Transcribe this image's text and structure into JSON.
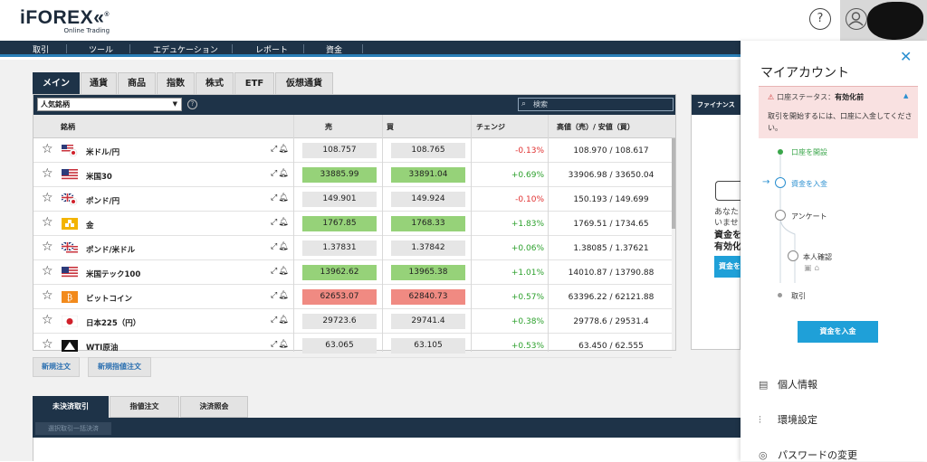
{
  "header": {
    "logo_main": "iFOREX",
    "logo_mark": "«",
    "logo_reg": "®",
    "logo_sub": "Online Trading",
    "help_icon": "?"
  },
  "nav": [
    "取引",
    "ツール",
    "エデュケーション",
    "レポート",
    "資金"
  ],
  "tabs": [
    "メイン",
    "通貨",
    "商品",
    "指数",
    "株式",
    "ETF",
    "仮想通貨"
  ],
  "toolbar": {
    "select_value": "人気銘柄",
    "search_placeholder": "検索"
  },
  "columns": [
    "銘柄",
    "売",
    "買",
    "チェンジ",
    "高値（売）/ 安値（買）"
  ],
  "rows": [
    {
      "name": "米ドル/円",
      "flag": "us-jp",
      "sell": "108.757",
      "buy": "108.765",
      "sell_state": "neutral",
      "buy_state": "neutral",
      "change": "-0.13%",
      "dir": "neg",
      "hilo": "108.970 / 108.617"
    },
    {
      "name": "米国30",
      "flag": "us",
      "sell": "33885.99",
      "buy": "33891.04",
      "sell_state": "up",
      "buy_state": "up",
      "change": "+0.69%",
      "dir": "pos",
      "hilo": "33906.98 / 33650.04"
    },
    {
      "name": "ポンド/円",
      "flag": "gb-jp",
      "sell": "149.901",
      "buy": "149.924",
      "sell_state": "neutral",
      "buy_state": "neutral",
      "change": "-0.10%",
      "dir": "neg",
      "hilo": "150.193 / 149.699"
    },
    {
      "name": "金",
      "flag": "gold",
      "sell": "1767.85",
      "buy": "1768.33",
      "sell_state": "up",
      "buy_state": "up",
      "change": "+1.83%",
      "dir": "pos",
      "hilo": "1769.51 / 1734.65"
    },
    {
      "name": "ポンド/米ドル",
      "flag": "gb-us",
      "sell": "1.37831",
      "buy": "1.37842",
      "sell_state": "neutral",
      "buy_state": "neutral",
      "change": "+0.06%",
      "dir": "pos",
      "hilo": "1.38085 / 1.37621"
    },
    {
      "name": "米国テック100",
      "flag": "us",
      "sell": "13962.62",
      "buy": "13965.38",
      "sell_state": "up",
      "buy_state": "up",
      "change": "+1.01%",
      "dir": "pos",
      "hilo": "14010.87 / 13790.88"
    },
    {
      "name": "ビットコイン",
      "flag": "btc",
      "sell": "62653.07",
      "buy": "62840.73",
      "sell_state": "down",
      "buy_state": "down",
      "change": "+0.57%",
      "dir": "pos",
      "hilo": "63396.22 / 62121.88"
    },
    {
      "name": "日本225（円）",
      "flag": "jp",
      "sell": "29723.6",
      "buy": "29741.4",
      "sell_state": "neutral",
      "buy_state": "neutral",
      "change": "+0.38%",
      "dir": "pos",
      "hilo": "29778.6 / 29531.4"
    },
    {
      "name": "WTI原油",
      "flag": "oil",
      "sell": "63.065",
      "buy": "63.105",
      "sell_state": "neutral",
      "buy_state": "neutral",
      "change": "+0.53%",
      "dir": "pos",
      "hilo": "63.450 / 62.555"
    }
  ],
  "order_buttons": [
    "新規注文",
    "新規指値注文"
  ],
  "side_panel": {
    "title": "ファイナンス",
    "text1": "あなた",
    "text2": "いませ",
    "text3": "資金を",
    "text4": "有効化",
    "button": "資金を"
  },
  "bottom_tabs": [
    "未決済取引",
    "指値注文",
    "決済照会"
  ],
  "bottom_button": "選択取引一括決済",
  "account": {
    "title": "マイアカウント",
    "close_icon": "✕",
    "status_label": "口座ステータス：",
    "status_value": "有効化前",
    "status_desc": "取引を開始するには、口座に入金してください。",
    "steps": [
      "口座を開設",
      "資金を入金",
      "アンケート",
      "本人確認",
      "取引"
    ],
    "deposit_button": "資金を入金",
    "menu": [
      "個人情報",
      "環境設定",
      "パスワードの変更"
    ]
  },
  "colors": {
    "navy": "#1e3348",
    "accent": "#1fa0d8",
    "up": "#96d279",
    "down": "#f08a82",
    "pos": "#2ca02c",
    "neg": "#e03030"
  }
}
